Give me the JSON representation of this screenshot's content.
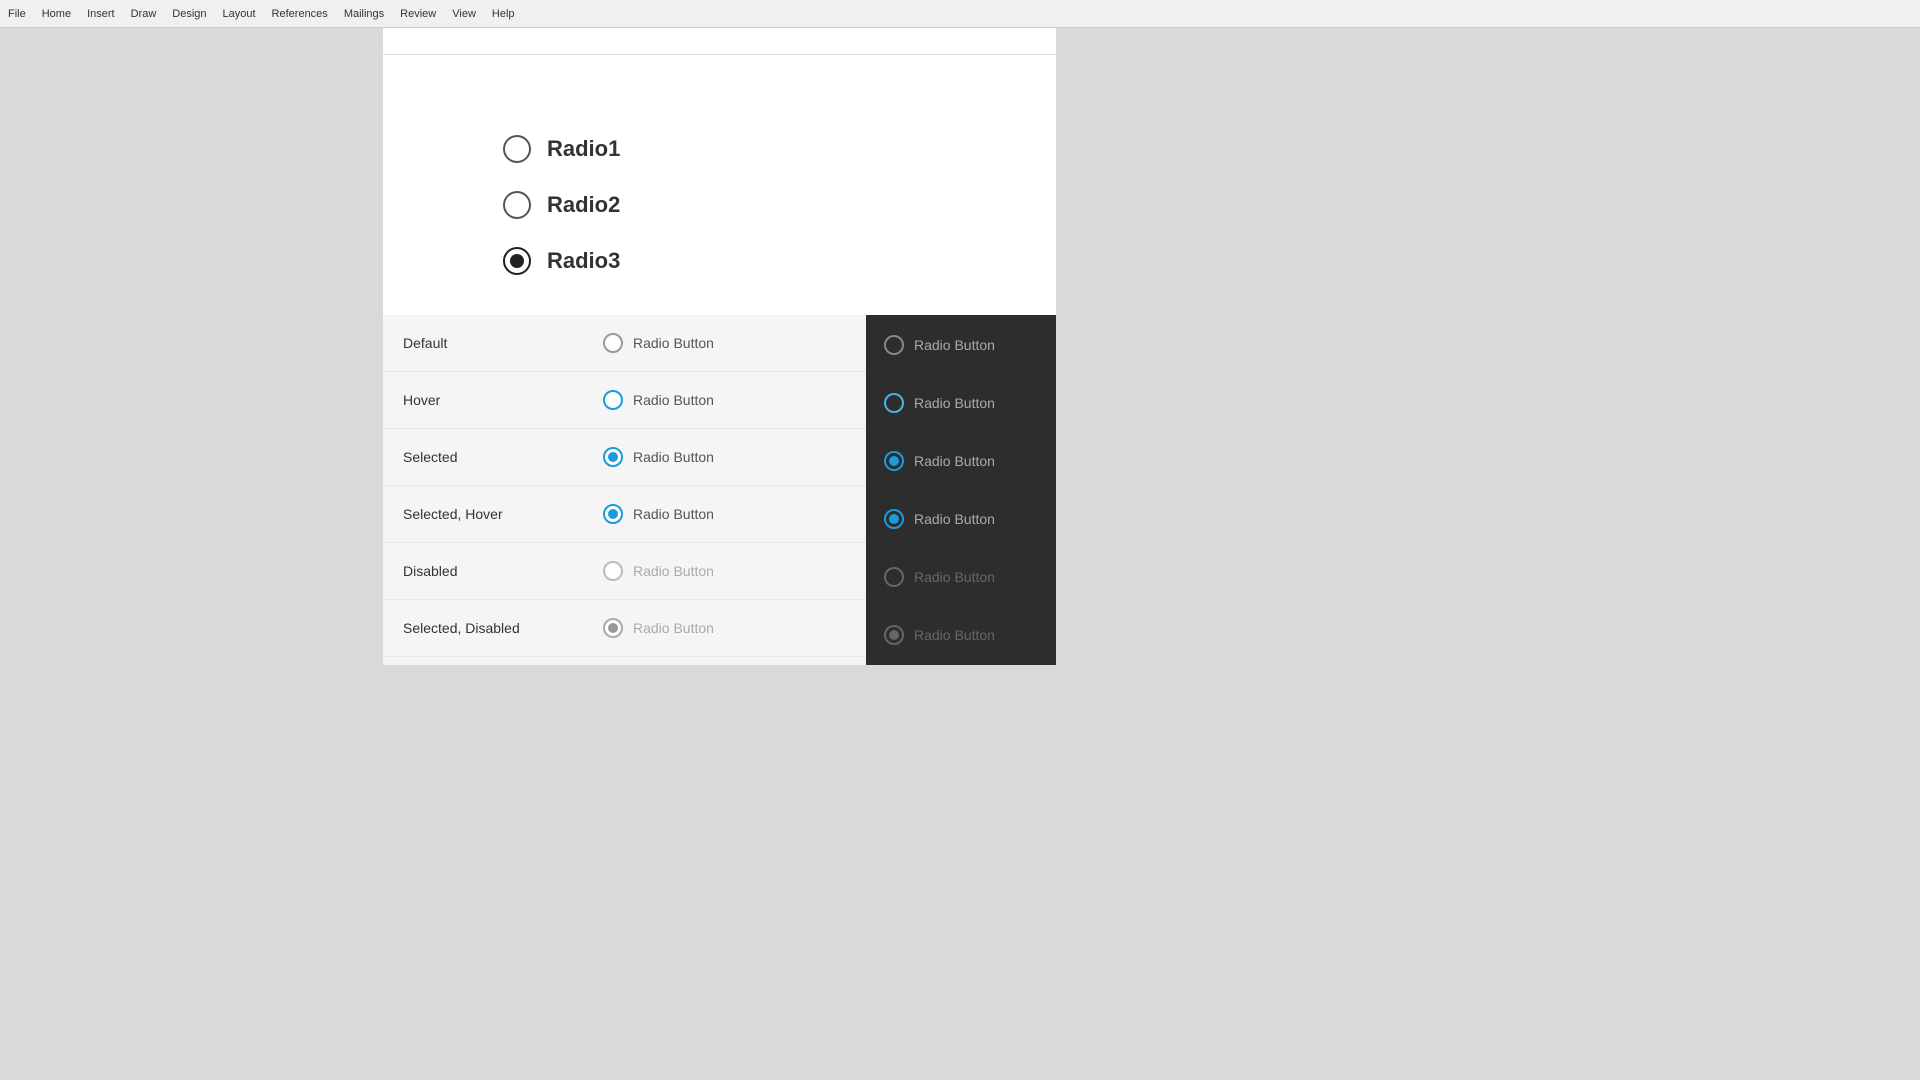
{
  "topbar": {
    "menu_items": [
      "File",
      "Home",
      "Insert",
      "Draw",
      "Design",
      "Layout",
      "References",
      "Mailings",
      "Review",
      "View",
      "Help"
    ]
  },
  "radio_preview": {
    "items": [
      {
        "label": "Radio1",
        "selected": false
      },
      {
        "label": "Radio2",
        "selected": false
      },
      {
        "label": "Radio3",
        "selected": true
      }
    ]
  },
  "states_table": {
    "rows": [
      {
        "state": "Default",
        "label": "Radio Button"
      },
      {
        "state": "Hover",
        "label": "Radio Button"
      },
      {
        "state": "Selected",
        "label": "Radio Button"
      },
      {
        "state": "Selected, Hover",
        "label": "Radio Button"
      },
      {
        "state": "Disabled",
        "label": "Radio Button"
      },
      {
        "state": "Selected, Disabled",
        "label": "Radio Button"
      }
    ]
  },
  "colors": {
    "blue": "#1a9bdc",
    "dark_bg": "#2d2d2d",
    "light_bg": "#f5f5f5",
    "text_primary": "#333333",
    "text_disabled": "#aaaaaa"
  }
}
